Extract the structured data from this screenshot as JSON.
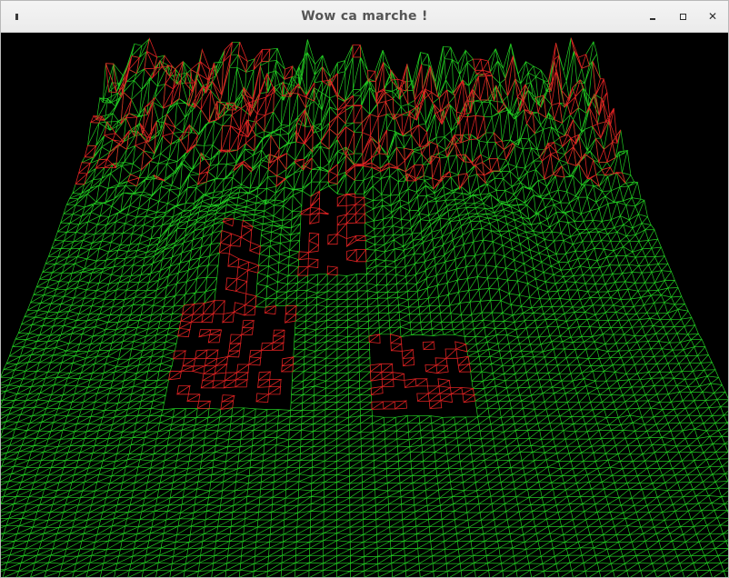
{
  "window": {
    "title": "Wow ca marche !",
    "icons": {
      "menu": "window-menu-icon",
      "minimize": "minimize-icon",
      "maximize": "maximize-icon",
      "close": "close-icon"
    }
  },
  "viewport": {
    "background_color": "#000000",
    "mesh_color": "#22cc22",
    "hole_edge_color": "#dd2222",
    "content": "3d-wireframe-terrain-mesh"
  }
}
